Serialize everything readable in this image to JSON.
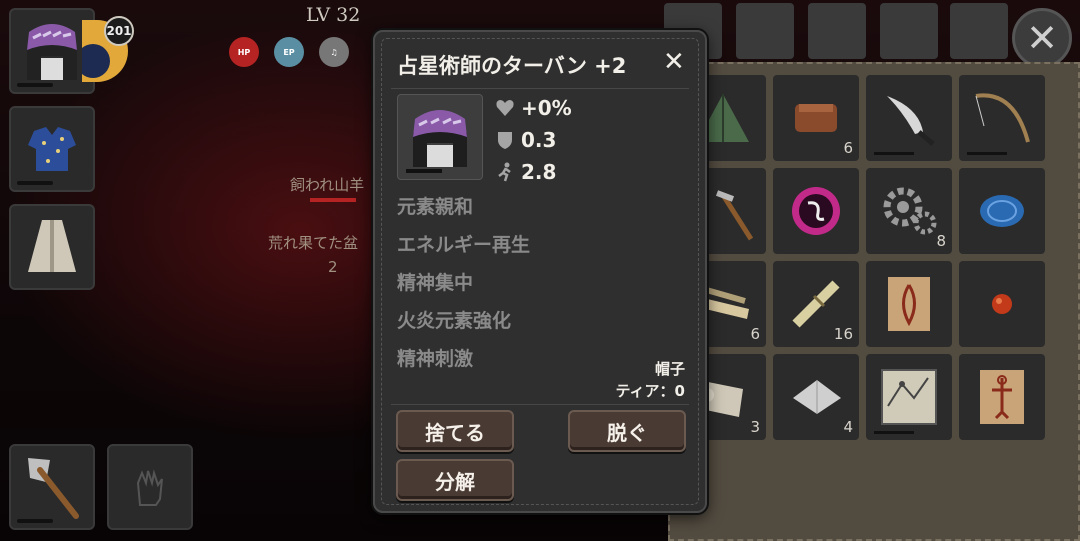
{
  "hud": {
    "level": "LV 32",
    "level_badge": "201",
    "stats": [
      {
        "label": "HP",
        "color": "#b52323"
      },
      {
        "label": "EP",
        "color": "#5a8fa3"
      },
      {
        "label": "",
        "color": "#8a8a8a"
      }
    ]
  },
  "world": {
    "enemy_name_1": "飼われ山羊",
    "enemy_name_2": "荒れ果てた盆",
    "enemy_level": "2"
  },
  "equip_slots": [
    {
      "icon": "turban-icon"
    },
    {
      "icon": "blue-robe-icon"
    },
    {
      "icon": "cloak-icon"
    }
  ],
  "hotbar": [
    {
      "icon": "axe-icon"
    },
    {
      "icon": "hand-icon"
    }
  ],
  "inventory": {
    "close_glyph": "✕",
    "cells": [
      {
        "icon": "tent-icon",
        "count": ""
      },
      {
        "icon": "brick-icon",
        "count": "6"
      },
      {
        "icon": "knife-icon",
        "count": ""
      },
      {
        "icon": "fishing-rod-icon",
        "count": ""
      },
      {
        "icon": "pickaxe-icon",
        "count": ""
      },
      {
        "icon": "purple-orb-icon",
        "count": ""
      },
      {
        "icon": "gear-icon",
        "count": "8"
      },
      {
        "icon": "blue-gem-icon",
        "count": ""
      },
      {
        "icon": "log-bundle-icon",
        "count": "6"
      },
      {
        "icon": "straw-bundle-icon",
        "count": "16"
      },
      {
        "icon": "scroll-rune-icon",
        "count": ""
      },
      {
        "icon": "red-seed-icon",
        "count": ""
      },
      {
        "icon": "paper-roll-icon",
        "count": "3"
      },
      {
        "icon": "cloth-icon",
        "count": "4"
      },
      {
        "icon": "map-icon",
        "count": ""
      },
      {
        "icon": "body-chart-icon",
        "count": ""
      }
    ]
  },
  "popup": {
    "title": "占星術師のターバン +2",
    "close_glyph": "✕",
    "item_icon": "turban-icon",
    "stats": {
      "hp": "+0%",
      "defense": "0.3",
      "speed": "2.8"
    },
    "enchantments": [
      "元素親和",
      "エネルギー再生",
      "精神集中",
      "火炎元素強化",
      "精神刺激"
    ],
    "category": "帽子",
    "tier": "ティア：0",
    "buttons": {
      "discard": "捨てる",
      "unequip": "脱ぐ",
      "disassemble": "分解"
    },
    "colors": {
      "button_bg": "#4a3a34",
      "panel_bg": "#2f2f2f"
    }
  }
}
